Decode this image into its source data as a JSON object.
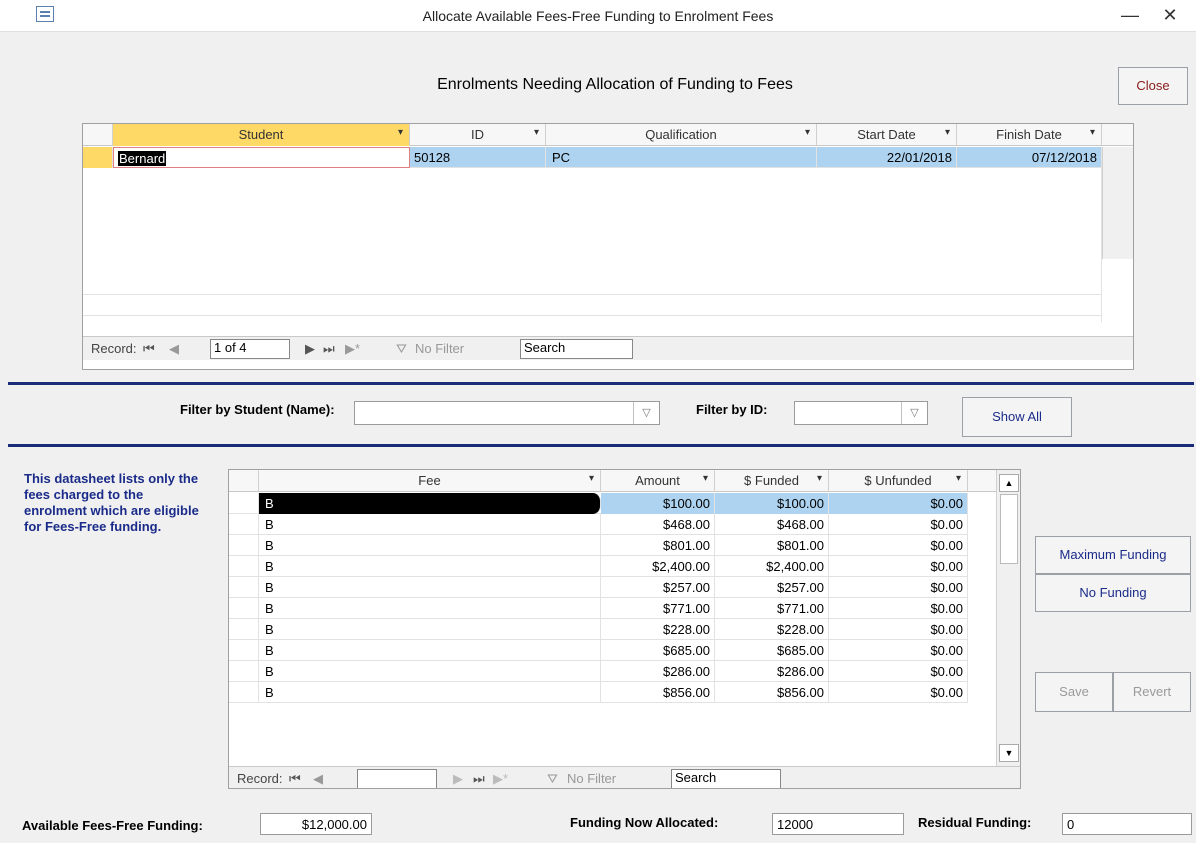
{
  "window": {
    "title": "Allocate Available Fees-Free Funding to Enrolment Fees",
    "minimize": "—",
    "close": "✕"
  },
  "heading": "Enrolments Needing Allocation of Funding to Fees",
  "close_button": "Close",
  "enrolments": {
    "columns": [
      "Student",
      "ID",
      "Qualification",
      "Start Date",
      "Finish Date"
    ],
    "rows": [
      {
        "student": "Bernard",
        "id": "50128",
        "qualification": "PC",
        "start": "22/01/2018",
        "finish": "07/12/2018"
      }
    ],
    "nav": {
      "record_label": "Record:",
      "current": "1 of 4",
      "no_filter": "No Filter",
      "search": "Search"
    }
  },
  "filters": {
    "student_label": "Filter by Student (Name):",
    "student_value": "",
    "id_label": "Filter by ID:",
    "id_value": "",
    "show_all": "Show All"
  },
  "note": "This datasheet lists only the fees charged to the enrolment which are eligible for Fees-Free funding.",
  "fees": {
    "columns": [
      "Fee",
      "Amount",
      "$ Funded",
      "$ Unfunded"
    ],
    "rows": [
      {
        "fee": "B",
        "amount": "$100.00",
        "funded": "$100.00",
        "unfunded": "$0.00"
      },
      {
        "fee": "B",
        "amount": "$468.00",
        "funded": "$468.00",
        "unfunded": "$0.00"
      },
      {
        "fee": "B",
        "amount": "$801.00",
        "funded": "$801.00",
        "unfunded": "$0.00"
      },
      {
        "fee": "B",
        "amount": "$2,400.00",
        "funded": "$2,400.00",
        "unfunded": "$0.00"
      },
      {
        "fee": "B",
        "amount": "$257.00",
        "funded": "$257.00",
        "unfunded": "$0.00"
      },
      {
        "fee": "B",
        "amount": "$771.00",
        "funded": "$771.00",
        "unfunded": "$0.00"
      },
      {
        "fee": "B",
        "amount": "$228.00",
        "funded": "$228.00",
        "unfunded": "$0.00"
      },
      {
        "fee": "B",
        "amount": "$685.00",
        "funded": "$685.00",
        "unfunded": "$0.00"
      },
      {
        "fee": "B",
        "amount": "$286.00",
        "funded": "$286.00",
        "unfunded": "$0.00"
      },
      {
        "fee": "B",
        "amount": "$856.00",
        "funded": "$856.00",
        "unfunded": "$0.00"
      }
    ],
    "nav": {
      "record_label": "Record:",
      "current": "",
      "no_filter": "No Filter",
      "search": "Search"
    }
  },
  "buttons": {
    "max_funding": "Maximum Funding",
    "no_funding": "No Funding",
    "save": "Save",
    "revert": "Revert"
  },
  "footer": {
    "available_label": "Available Fees-Free Funding:",
    "available_value": "$12,000.00",
    "allocated_label": "Funding Now Allocated:",
    "allocated_value": "12000",
    "residual_label": "Residual Funding:",
    "residual_value": "0"
  },
  "colors": {
    "selected_row": "#aed3f0",
    "header_highlight": "#ffd966",
    "accent_text": "#1a2b8a",
    "separator": "#1a2b7a"
  }
}
